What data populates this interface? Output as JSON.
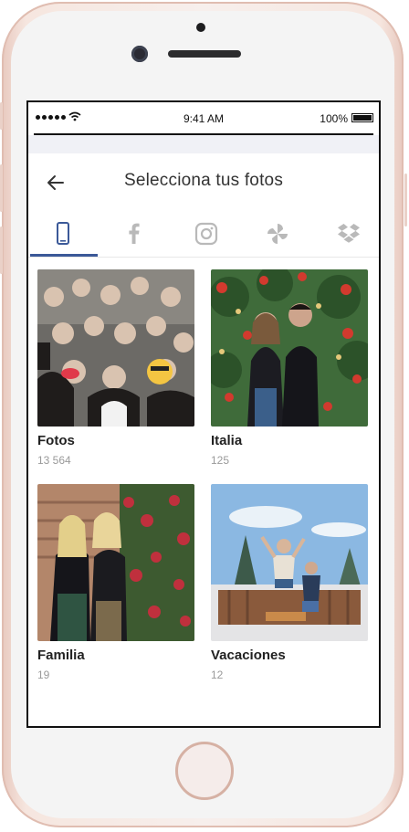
{
  "status_bar": {
    "time": "9:41 AM",
    "battery": "100%"
  },
  "header": {
    "title": "Selecciona tus fotos"
  },
  "tabs": [
    {
      "id": "device",
      "icon": "phone-icon",
      "active": true
    },
    {
      "id": "facebook",
      "icon": "facebook-icon",
      "active": false
    },
    {
      "id": "instagram",
      "icon": "instagram-icon",
      "active": false
    },
    {
      "id": "google-photos",
      "icon": "pinwheel-icon",
      "active": false
    },
    {
      "id": "dropbox",
      "icon": "dropbox-icon",
      "active": false
    }
  ],
  "albums": [
    {
      "name": "Fotos",
      "count": "13 564"
    },
    {
      "name": "Italia",
      "count": "125"
    },
    {
      "name": "Familia",
      "count": "19"
    },
    {
      "name": "Vacaciones",
      "count": "12"
    }
  ],
  "colors": {
    "accent": "#3b5998",
    "icon_grey": "#b9b9b9",
    "title": "#333333"
  }
}
